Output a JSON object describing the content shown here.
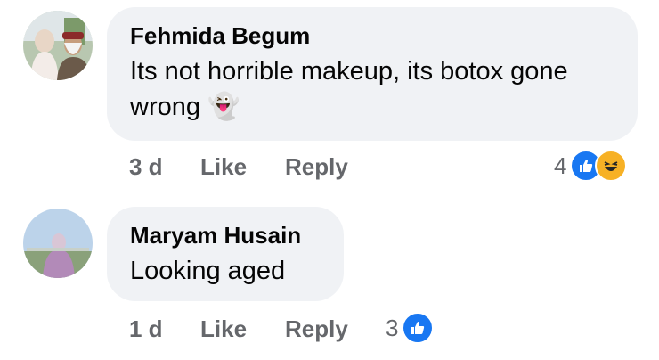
{
  "comments": [
    {
      "author": "Fehmida Begum",
      "text": "Its not horrible makeup, its botox gone wrong",
      "emoji": "👻",
      "time": "3 d",
      "like_label": "Like",
      "reply_label": "Reply",
      "reaction_count": "4",
      "reactions": [
        "like-icon",
        "haha-icon"
      ]
    },
    {
      "author": "Maryam Husain",
      "text": "Looking aged",
      "time": "1 d",
      "like_label": "Like",
      "reply_label": "Reply",
      "reaction_count": "3",
      "reactions": [
        "like-icon"
      ]
    }
  ],
  "colors": {
    "bubble": "#f0f2f5",
    "meta_text": "#65676b",
    "like_blue": "#1877f2",
    "haha_yellow": "#f7b125"
  }
}
